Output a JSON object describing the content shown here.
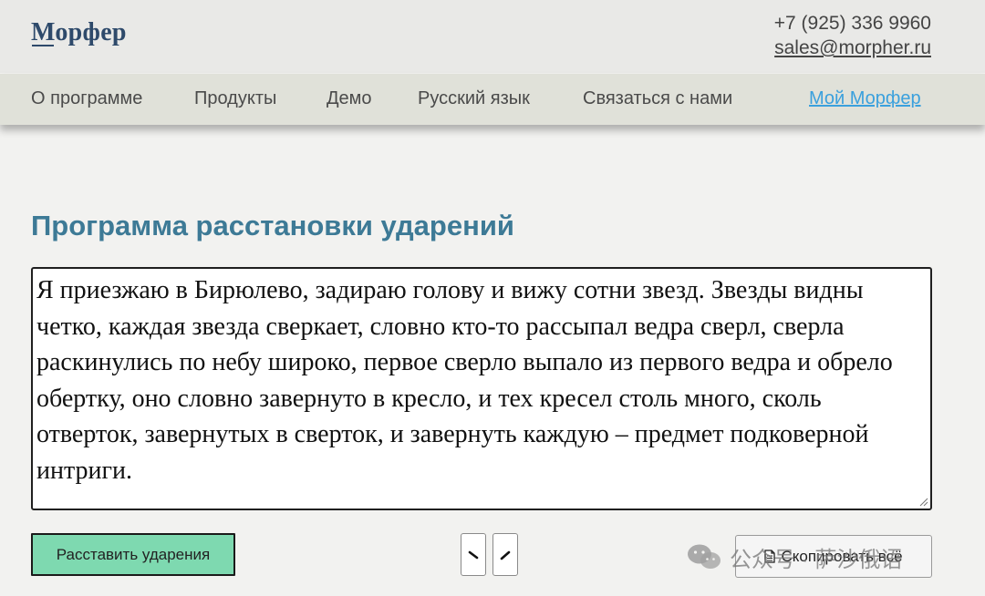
{
  "header": {
    "logo": "Морфер",
    "phone": "+7 (925) 336 9960",
    "email": "sales@morpher.ru"
  },
  "nav": {
    "items": [
      {
        "label": "О программе"
      },
      {
        "label": "Продукты"
      },
      {
        "label": "Демо"
      },
      {
        "label": "Русский язык"
      },
      {
        "label": "Связаться с нами"
      },
      {
        "label": "Мой Морфер"
      }
    ]
  },
  "main": {
    "title": "Программа расстановки ударений",
    "text_value": "Я приезжаю в Бирюлево, задираю голову и вижу сотни звезд. Звезды видны четко, каждая звезда сверкает, словно кто-то рассыпал ведра сверл, сверла раскинулись по небу широко, первое сверло выпало из первого ведра и обрело обертку, оно словно завернуто в кресло, и тех кресел столь много, сколь отверток, завернутых в сверток, и завернуть каждую – предмет подковерной интриги.",
    "stress_button_label": "Расставить ударения",
    "grave_accent_button": "`",
    "acute_accent_button": "´",
    "copy_button_label": "Скопировать всё"
  },
  "watermark": {
    "text": "公众号 · 萨沙俄语"
  },
  "colors": {
    "title": "#3d7a96",
    "accent_button": "#7ed9b0",
    "active_nav": "#3aa0dd",
    "logo": "#2e4a6b"
  }
}
